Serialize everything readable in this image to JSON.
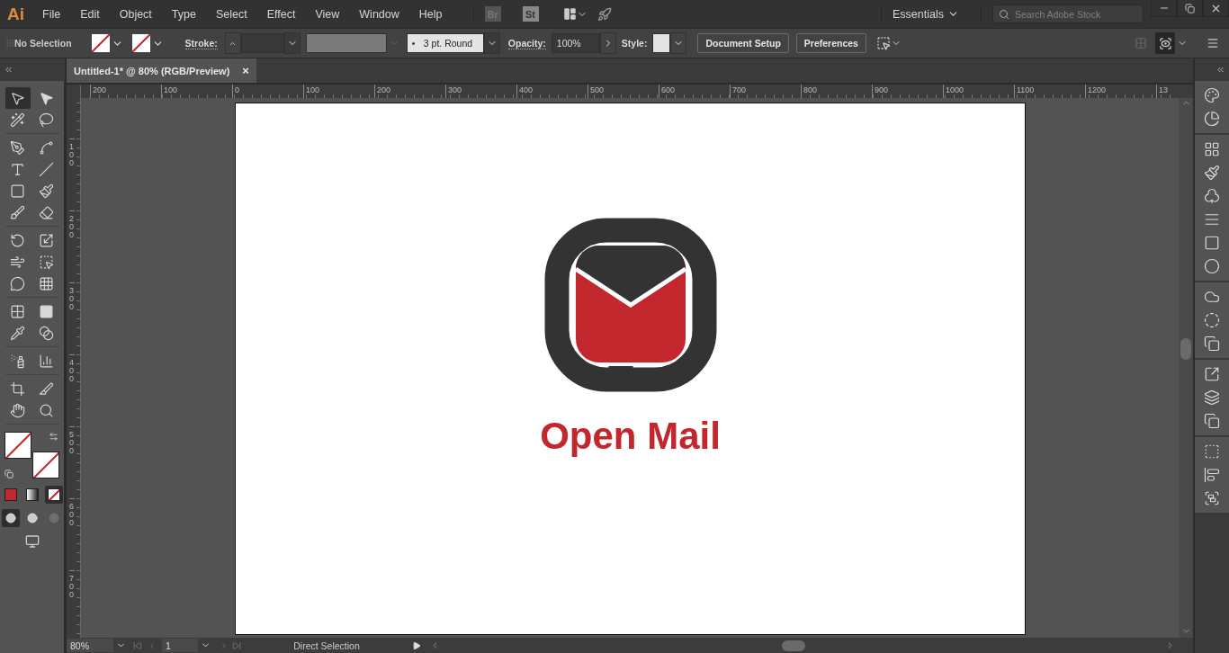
{
  "app": {
    "logo": "Ai",
    "menus": [
      "File",
      "Edit",
      "Object",
      "Type",
      "Select",
      "Effect",
      "View",
      "Window",
      "Help"
    ],
    "bridge": "Br",
    "stock": "St",
    "workspace": "Essentials",
    "search": {
      "placeholder": "Search Adobe Stock"
    }
  },
  "control_bar": {
    "selection": "No Selection",
    "stroke_label": "Stroke:",
    "brush": "3 pt. Round",
    "opacity_label": "Opacity:",
    "opacity": "100%",
    "style_label": "Style:",
    "buttons": [
      "Document Setup",
      "Preferences"
    ]
  },
  "document_tab": {
    "title": "Untitled-1* @ 80% (RGB/Preview)",
    "close": "×"
  },
  "tools": [
    {
      "selected": true
    },
    {
      "selected": false
    },
    {
      "selected": false
    },
    {
      "selected": false
    },
    {
      "selected": false
    },
    {
      "selected": false
    },
    {
      "selected": false
    },
    {
      "selected": false
    },
    {
      "selected": false
    },
    {
      "selected": false
    },
    {
      "selected": false
    },
    {
      "selected": false
    },
    {
      "selected": false
    },
    {
      "selected": false
    },
    {
      "selected": false
    },
    {
      "selected": false
    },
    {
      "selected": false
    },
    {
      "selected": false
    },
    {
      "selected": false
    },
    {
      "selected": false
    },
    {
      "selected": false
    },
    {
      "selected": false
    },
    {
      "selected": false
    },
    {
      "selected": false
    },
    {
      "selected": false
    },
    {
      "selected": false
    },
    {
      "selected": false
    },
    {
      "selected": false
    }
  ],
  "color_modes": [
    {
      "kind": "color",
      "selected": false
    },
    {
      "kind": "gradient",
      "selected": false
    },
    {
      "kind": "none",
      "selected": true
    }
  ],
  "draw_modes": [
    {
      "selected": true,
      "disabled": false
    },
    {
      "selected": false,
      "disabled": false
    },
    {
      "selected": false,
      "disabled": true
    }
  ],
  "rulers": {
    "horizontal": [
      "200",
      "100",
      "0",
      "100",
      "200",
      "300",
      "400",
      "500",
      "600",
      "700",
      "800",
      "900",
      "1000",
      "1100",
      "1200",
      "13"
    ],
    "vertical": [
      "100",
      "200",
      "300",
      "400",
      "500",
      "600",
      "700"
    ]
  },
  "artwork": {
    "title": "Open Mail"
  },
  "status_bar": {
    "zoom": "80%",
    "artboard": "1",
    "tool": "Direct Selection"
  }
}
